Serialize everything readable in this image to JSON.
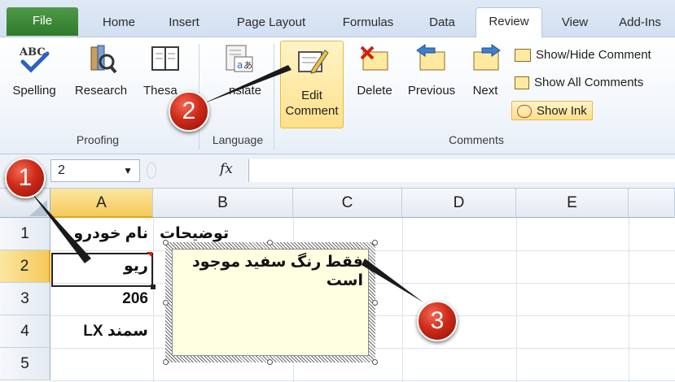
{
  "tabs": [
    "File",
    "Home",
    "Insert",
    "Page Layout",
    "Formulas",
    "Data",
    "Review",
    "View",
    "Add-Ins"
  ],
  "active_tab": "Review",
  "ribbon": {
    "proofing": {
      "spelling": "Spelling",
      "research": "Research",
      "thesaurus": "Thesa",
      "group": "Proofing"
    },
    "language": {
      "translate": "nslate",
      "group": "Language"
    },
    "comments": {
      "edit_line1": "Edit",
      "edit_line2": "Comment",
      "delete": "Delete",
      "previous": "Previous",
      "next": "Next",
      "show_hide": "Show/Hide Comment",
      "show_all": "Show All Comments",
      "show_ink": "Show Ink",
      "group": "Comments"
    }
  },
  "formula_bar": {
    "name_box": "2",
    "fx": "fx"
  },
  "grid": {
    "columns": [
      "A",
      "B",
      "C",
      "D",
      "E"
    ],
    "rows": [
      "1",
      "2",
      "3",
      "4",
      "5"
    ],
    "cells": [
      "نام خودرو",
      "ریو",
      "206",
      "سمند LX",
      ""
    ],
    "b1_overflow": "توضیحات"
  },
  "comment": {
    "text": "فقط رنگ سفید موجود است"
  },
  "callouts": [
    "1",
    "2",
    "3"
  ],
  "colors": {
    "file_tab": "#3a8a34",
    "highlight": "#ffe08a",
    "callout": "#cf2a19",
    "comment_bg": "#ffffe1"
  }
}
